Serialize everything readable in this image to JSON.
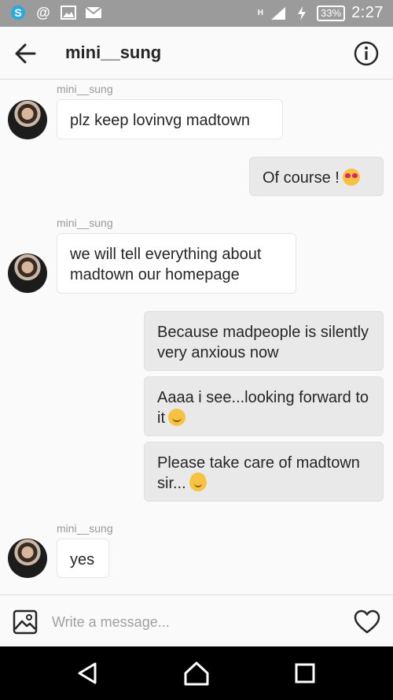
{
  "status_bar": {
    "icons": [
      "skype-icon",
      "at-icon",
      "image-icon",
      "mail-icon"
    ],
    "network": "H",
    "battery": "33%",
    "time": "2:27"
  },
  "header": {
    "title": "mini__sung",
    "back_icon": "arrow-left-icon",
    "info_icon": "info-icon"
  },
  "messages": [
    {
      "from": "mini__sung",
      "sender_label": "mini__sung",
      "text": "plz keep lovinvg madtown"
    },
    {
      "from": "me",
      "text": "Of course !",
      "emoji": "heart-eyes-emoji"
    },
    {
      "from": "mini__sung",
      "sender_label": "mini__sung",
      "text": "we will tell everything about madtown our homepage"
    },
    {
      "from": "me",
      "text": "Because madpeople is silently very anxious now"
    },
    {
      "from": "me",
      "text": "Aaaa i see...looking forward to it",
      "emoji": "smile-emoji"
    },
    {
      "from": "me",
      "text": "Please take care of madtown sir...",
      "emoji": "halo-smile-emoji"
    },
    {
      "from": "mini__sung",
      "sender_label": "mini__sung",
      "text": "yes"
    }
  ],
  "composer": {
    "placeholder": "Write a message..."
  },
  "colors": {
    "status_bar": "#9b9b9b",
    "incoming_bubble": "#ffffff",
    "outgoing_bubble": "#e9e9e9",
    "text": "#262626"
  }
}
